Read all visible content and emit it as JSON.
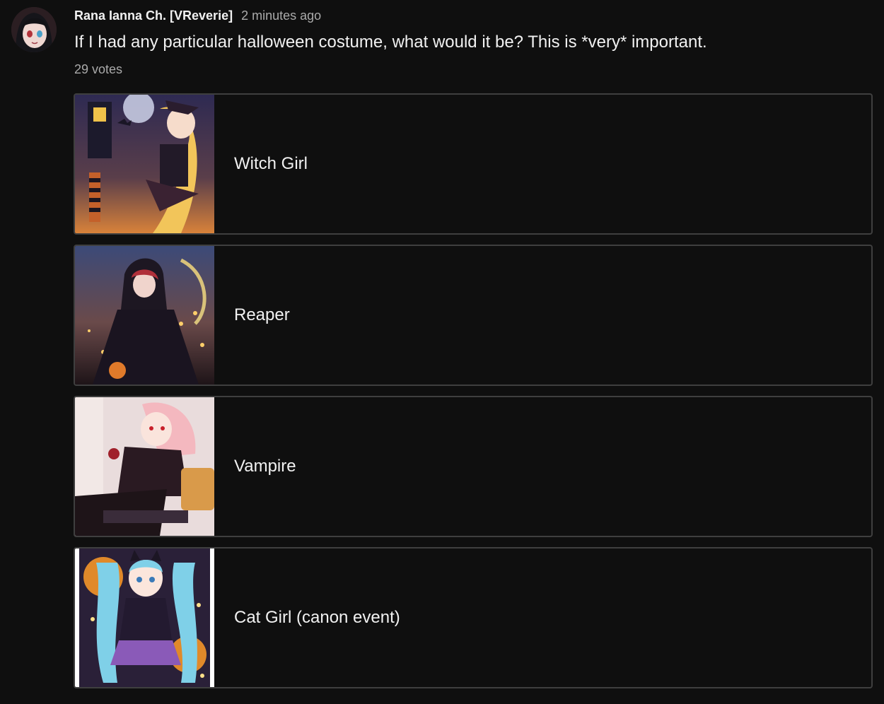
{
  "post": {
    "author": "Rana Ianna Ch. [VReverie]",
    "timestamp": "2 minutes ago",
    "question": "If I had any particular halloween costume, what would it be? This is *very* important.",
    "votes": "29 votes",
    "options": [
      {
        "label": "Witch Girl",
        "image": "witch-girl-illustration"
      },
      {
        "label": "Reaper",
        "image": "reaper-illustration"
      },
      {
        "label": "Vampire",
        "image": "vampire-illustration"
      },
      {
        "label": "Cat Girl (canon event)",
        "image": "cat-girl-illustration"
      }
    ]
  },
  "colors": {
    "background": "#0f0f0f",
    "border": "#3f3f3f",
    "primary_text": "#f1f1f1",
    "secondary_text": "#aaaaaa"
  }
}
